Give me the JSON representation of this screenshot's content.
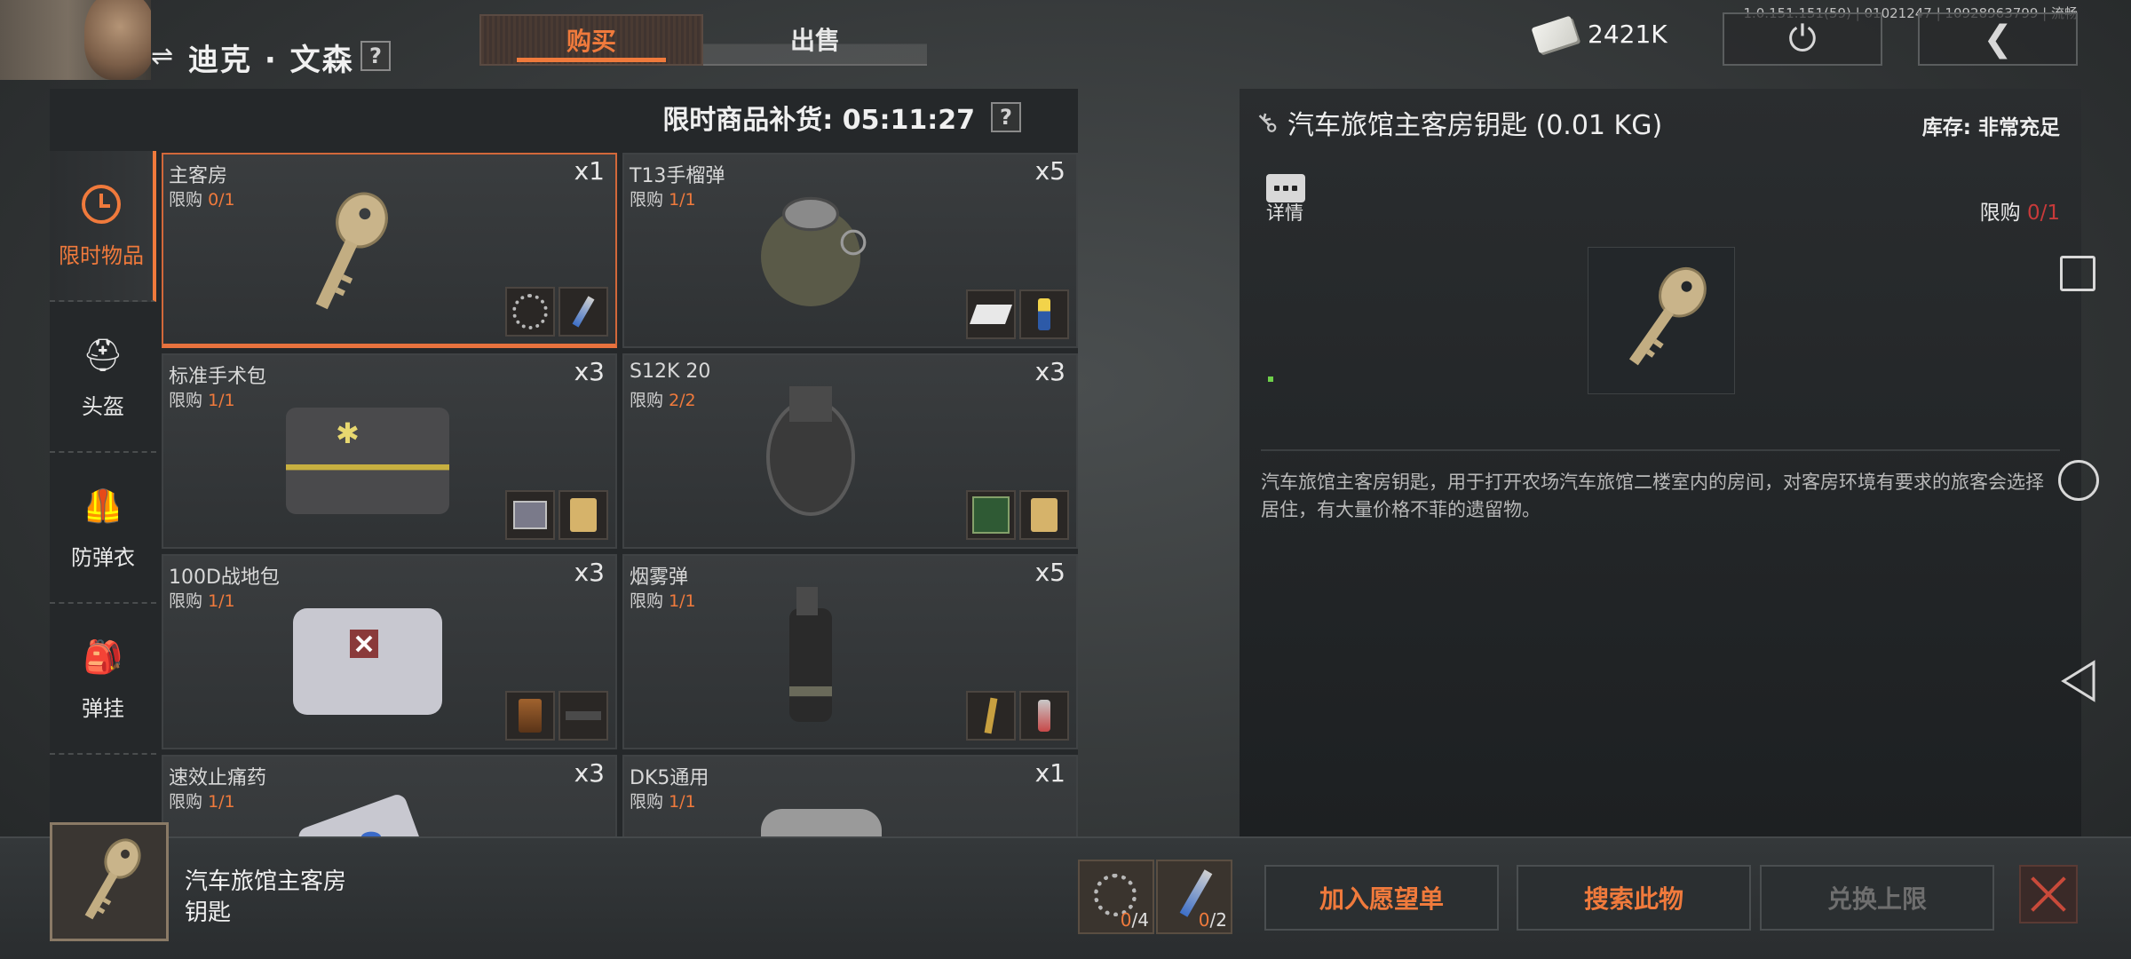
{
  "version": "1.0.151.151(59) | 01021247 | 10928963799 | 流畅",
  "trader": {
    "name": "迪克 · 文森",
    "switch_icon": "⇌",
    "help": "?"
  },
  "tabs": [
    {
      "label": "购买",
      "active": true
    },
    {
      "label": "出售",
      "active": false
    }
  ],
  "money": {
    "value": "2421K",
    "icon": "cash-icon"
  },
  "top_buttons": {
    "power_icon": "⏻",
    "back_icon": "❮"
  },
  "restock": {
    "label": "限时商品补货: 05:11:27",
    "help": "?"
  },
  "categories": [
    {
      "label": "限时物品",
      "icon": "clock-icon",
      "active": true
    },
    {
      "label": "头盔",
      "icon": "helmet-icon",
      "glyph": "⛑"
    },
    {
      "label": "防弹衣",
      "icon": "vest-icon",
      "glyph": "🦺"
    },
    {
      "label": "弹挂",
      "icon": "rig-icon",
      "glyph": "🎒"
    }
  ],
  "limit_label": "限购",
  "items": [
    {
      "name": "主客房",
      "limit": "0/1",
      "qty": "x1",
      "img": "key",
      "mats": [
        "cable",
        "pen"
      ],
      "selected": true
    },
    {
      "name": "T13手榴弹",
      "limit": "1/1",
      "qty": "x5",
      "img": "grenade",
      "mats": [
        "box",
        "spray"
      ]
    },
    {
      "name": "标准手术包",
      "limit": "1/1",
      "qty": "x3",
      "img": "surgkit",
      "mats": [
        "grey",
        "gold"
      ]
    },
    {
      "name": "S12K 20",
      "limit": "2/2",
      "qty": "x3",
      "img": "drum",
      "mats": [
        "board",
        "gold"
      ]
    },
    {
      "name": "100D战地包",
      "limit": "1/1",
      "qty": "x3",
      "img": "fieldkit",
      "mats": [
        "jar",
        "gun"
      ]
    },
    {
      "name": "烟雾弹",
      "limit": "1/1",
      "qty": "x5",
      "img": "smoke",
      "mats": [
        "stick",
        "bottle"
      ]
    },
    {
      "name": "速效止痛药",
      "limit": "1/1",
      "qty": "x3",
      "img": "pills",
      "mats": []
    },
    {
      "name": "DK5通用",
      "limit": "1/1",
      "qty": "x1",
      "img": "helmet",
      "mats": []
    }
  ],
  "detail": {
    "title": "汽车旅馆主客房钥匙 (0.01 KG)",
    "stock": "库存: 非常充足",
    "info_label": "详情",
    "limit_label": "限购",
    "limit": "0/1",
    "description": "汽车旅馆主客房钥匙，用于打开农场汽车旅馆二楼室内的房间，对客房环境有要求的旅客会选择居住，有大量价格不菲的遗留物。"
  },
  "bottom": {
    "selected_name": "汽车旅馆主客房钥匙",
    "requirements": [
      {
        "icon": "cable-icon",
        "have": "0",
        "need": "/4"
      },
      {
        "icon": "pen-icon",
        "have": "0",
        "need": "/2"
      }
    ],
    "wishlist_label": "加入愿望单",
    "search_label": "搜索此物",
    "exchange_label": "兑换上限"
  },
  "colors": {
    "accent": "#f07a3c",
    "danger": "#c83a3a"
  }
}
